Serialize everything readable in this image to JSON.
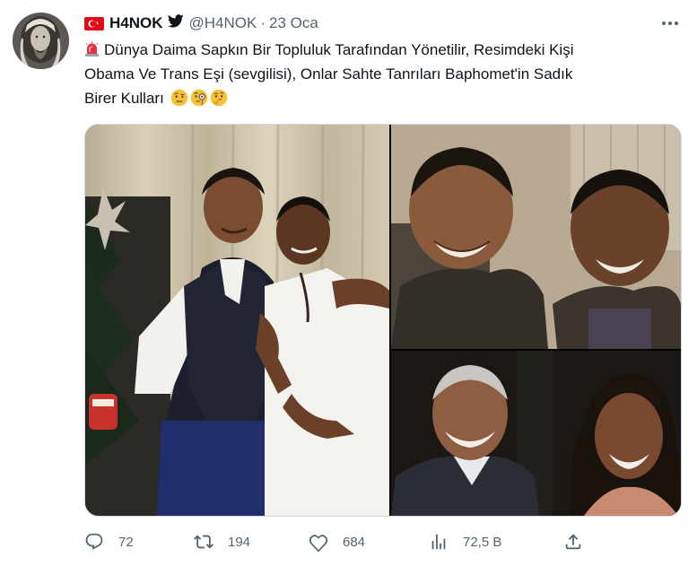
{
  "tweet": {
    "display_name": "H4NOK",
    "handle": "@H4NOK",
    "separator": "·",
    "date": "23 Oca",
    "text_lines": [
      "Dünya Daima Sapkın Bir Topluluk Tarafından Yönetilir, Resimdeki Kişi",
      "Obama Ve Trans Eşi (sevgilisi), Onlar Sahte Tanrıları Baphomet'in Sadık",
      "Birer Kulları"
    ],
    "leading_emoji": "siren-emoji",
    "trailing_emojis": [
      "face-with-raised-eyebrow-emoji",
      "face-with-monocle-emoji",
      "thinking-face-emoji"
    ],
    "flag": "turkey-flag",
    "verified_icon": "twitter-bird-icon"
  },
  "actions": {
    "replies": "72",
    "retweets": "194",
    "likes": "684",
    "views": "72,5 B"
  },
  "colors": {
    "text_primary": "#0f1419",
    "text_secondary": "#536471",
    "border": "#cfd9de",
    "flag_red": "#e30a17",
    "emoji_yellow": "#f7c23a"
  }
}
